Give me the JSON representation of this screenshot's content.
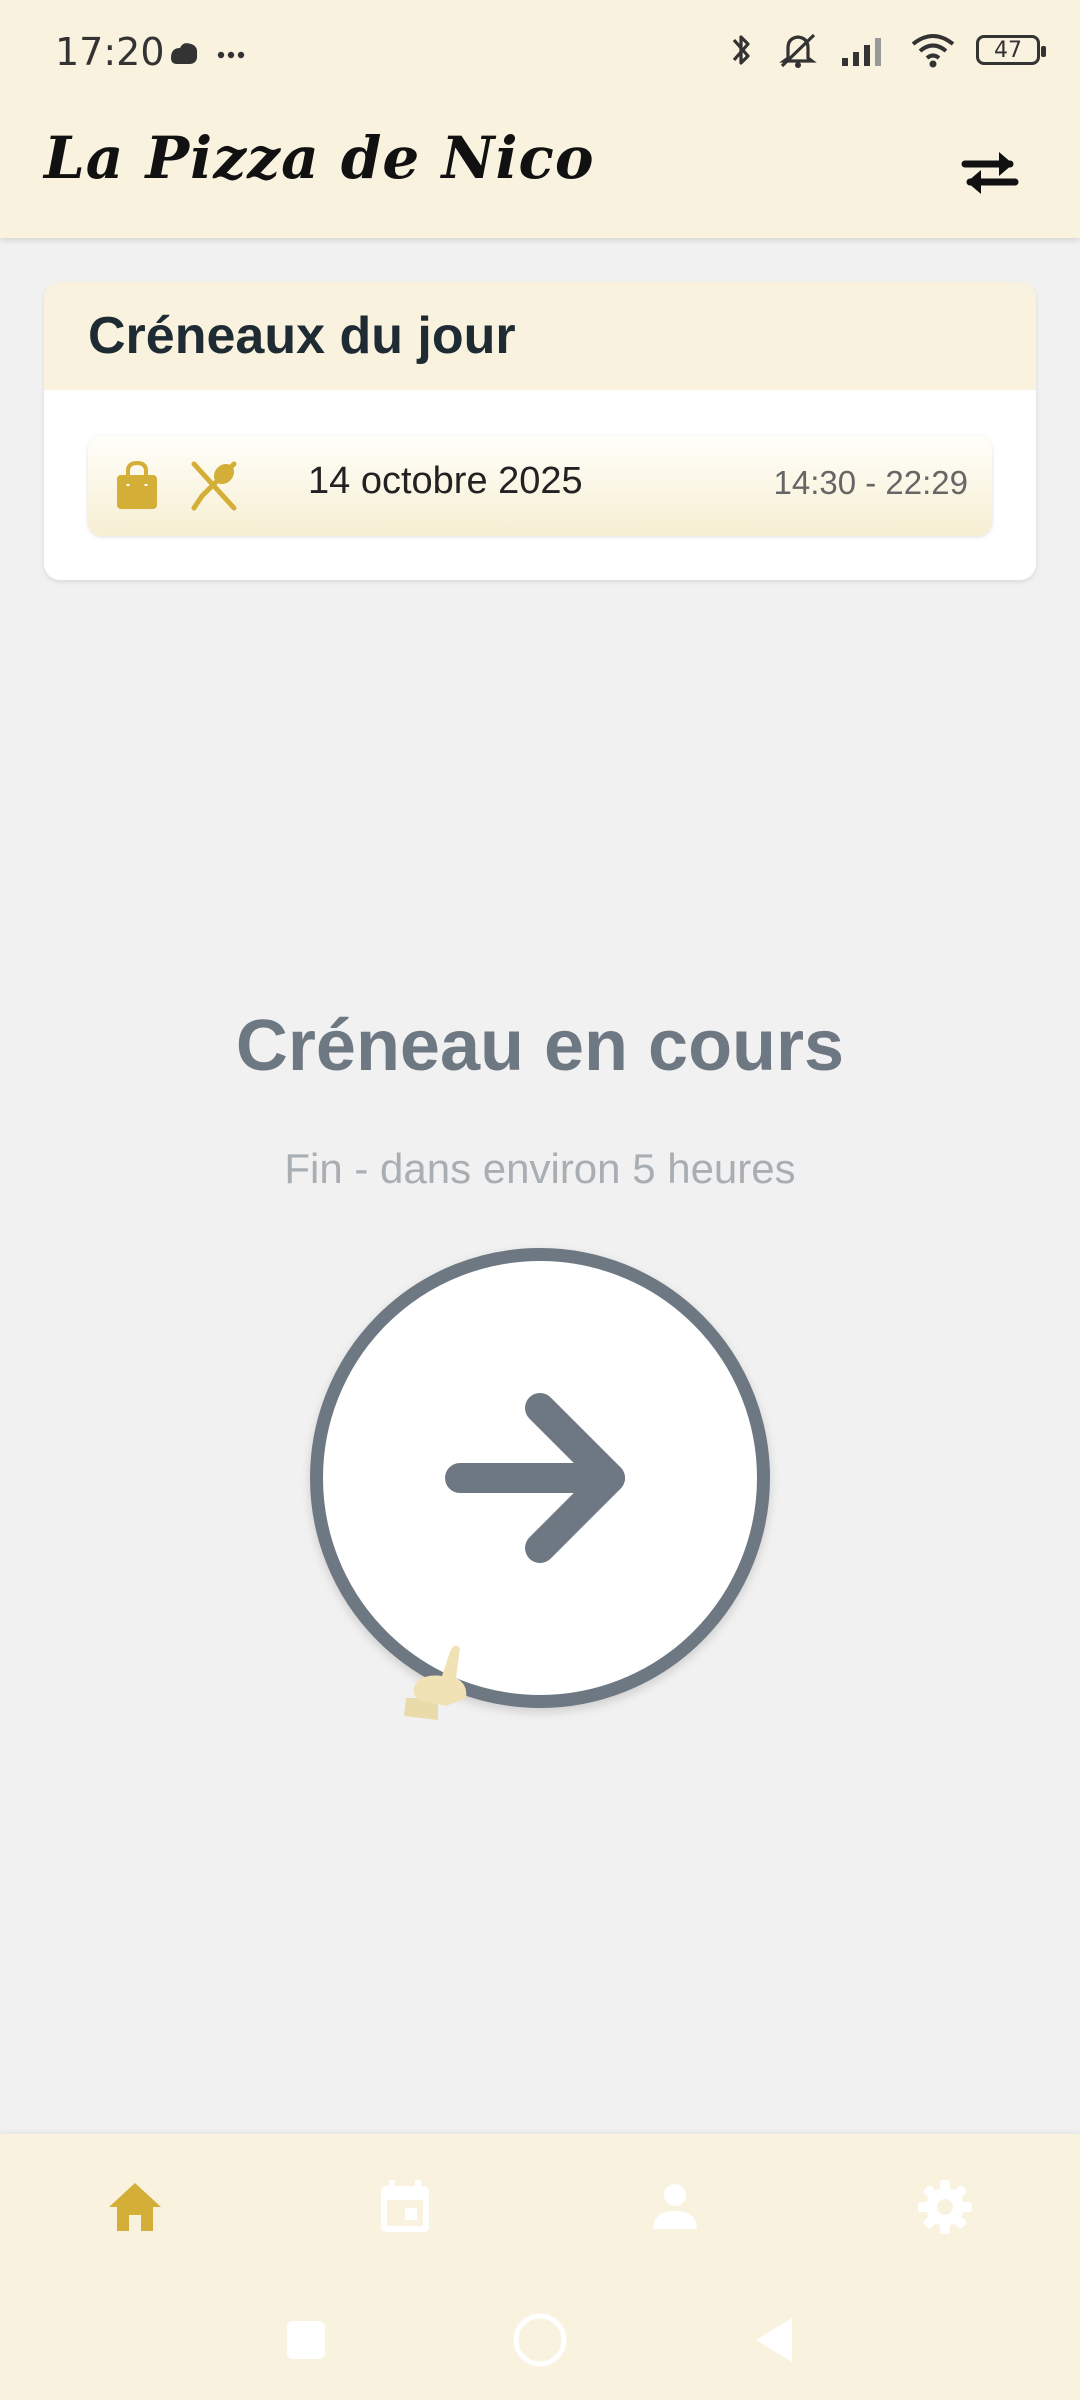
{
  "status_bar": {
    "time": "17:20",
    "battery_level": "47",
    "icons": [
      "cloud-icon",
      "more-dots-icon",
      "bluetooth-icon",
      "muted-bell-icon",
      "signal-icon",
      "wifi-icon",
      "battery-icon"
    ]
  },
  "app_bar": {
    "title": "La Pizza de Nico",
    "action_icon": "swap-icon"
  },
  "slots_card": {
    "title": "Créneaux du jour",
    "slot": {
      "icons": [
        "shopping-bag-icon",
        "utensils-icon"
      ],
      "date": "14 octobre 2025",
      "time_range": "14:30 - 22:29"
    }
  },
  "current_slot": {
    "title": "Créneau en cours",
    "subtitle": "Fin - dans environ 5 heures",
    "button_icon": "arrow-right-icon"
  },
  "bottom_nav": {
    "items": [
      {
        "icon": "home-icon",
        "active": true
      },
      {
        "icon": "calendar-icon",
        "active": false
      },
      {
        "icon": "person-icon",
        "active": false
      },
      {
        "icon": "gear-icon",
        "active": false
      }
    ]
  },
  "colors": {
    "accent": "#d4af37",
    "inactive": "#ffffff",
    "header_bg": "#f8f2df",
    "button_gray": "#6e7882"
  }
}
